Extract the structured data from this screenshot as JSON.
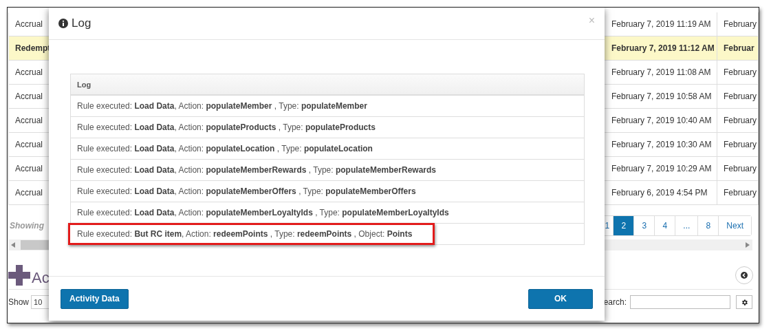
{
  "background": {
    "rows": [
      {
        "type": "Accrual",
        "date": "February 7, 2019 11:19 AM",
        "next": "February",
        "selected": false
      },
      {
        "type": "Redempt",
        "date": "February 7, 2019 11:12 AM",
        "next": "Februar",
        "selected": true
      },
      {
        "type": "Accrual",
        "date": "February 7, 2019 11:08 AM",
        "next": "February",
        "selected": false
      },
      {
        "type": "Accrual",
        "date": "February 7, 2019 10:58 AM",
        "next": "February",
        "selected": false
      },
      {
        "type": "Accrual",
        "date": "February 7, 2019 10:40 AM",
        "next": "February",
        "selected": false
      },
      {
        "type": "Accrual",
        "date": "February 7, 2019 10:30 AM",
        "next": "February",
        "selected": false
      },
      {
        "type": "Accrual",
        "date": "February 7, 2019 10:29 AM",
        "next": "February",
        "selected": false
      },
      {
        "type": "Accrual",
        "date": "February 6, 2019 4:54 PM",
        "next": "February",
        "selected": false
      }
    ],
    "showing": "Showing",
    "pages": [
      {
        "label": "1",
        "selected": false
      },
      {
        "label": "2",
        "selected": true
      },
      {
        "label": "3",
        "selected": false
      },
      {
        "label": "4",
        "selected": false
      },
      {
        "label": "...",
        "selected": false
      },
      {
        "label": "8",
        "selected": false
      },
      {
        "label": "Next",
        "selected": false
      }
    ],
    "section_title": "Ac",
    "show_label": "Show",
    "page_size": "10",
    "search_label": "earch:"
  },
  "modal": {
    "title": "Log",
    "close": "×",
    "table": {
      "header": "Log",
      "rows": [
        {
          "text": "Rule executed: **Load Data**, Action: **populateMember** , Type: **populateMember**",
          "highlighted": false
        },
        {
          "text": "Rule executed: **Load Data**, Action: **populateProducts** , Type: **populateProducts**",
          "highlighted": false
        },
        {
          "text": "Rule executed: **Load Data**, Action: **populateLocation** , Type: **populateLocation**",
          "highlighted": false
        },
        {
          "text": "Rule executed: **Load Data**, Action: **populateMemberRewards** , Type: **populateMemberRewards**",
          "highlighted": false
        },
        {
          "text": "Rule executed: **Load Data**, Action: **populateMemberOffers** , Type: **populateMemberOffers**",
          "highlighted": false
        },
        {
          "text": "Rule executed: **Load Data**, Action: **populateMemberLoyaltyIds** , Type: **populateMemberLoyaltyIds**",
          "highlighted": false
        },
        {
          "text": "Rule executed: **But RC item**, Action: **redeemPoints** , Type: **redeemPoints** , Object: **Points**",
          "highlighted": true
        }
      ]
    },
    "buttons": [
      "Activity Data",
      "OK"
    ]
  }
}
